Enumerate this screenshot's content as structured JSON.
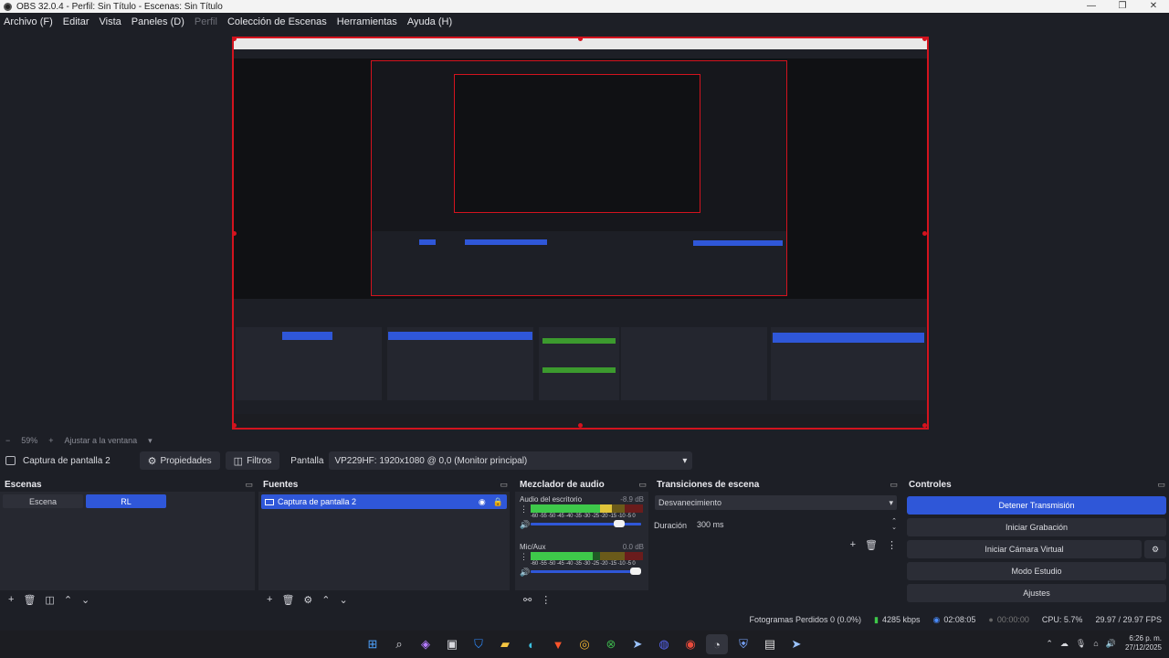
{
  "window": {
    "title": "OBS 32.0.4 - Perfil: Sin Título - Escenas: Sin Título"
  },
  "menu": [
    "Archivo (F)",
    "Editar",
    "Vista",
    "Paneles (D)",
    "Perfil",
    "Colección de Escenas",
    "Herramientas",
    "Ayuda (H)"
  ],
  "zoom": {
    "minus": "−",
    "value": "59%",
    "plus": "+",
    "fit_label": "Ajustar a la ventana"
  },
  "source_toolbar": {
    "source_name": "Captura de pantalla 2",
    "properties_label": "Propiedades",
    "filters_label": "Filtros",
    "screen_label": "Pantalla",
    "screen_value": "VP229HF: 1920x1080 @ 0,0 (Monitor principal)"
  },
  "scenes": {
    "title": "Escenas",
    "items": [
      "Escena",
      "RL"
    ],
    "active": "RL"
  },
  "sources": {
    "title": "Fuentes",
    "items": [
      "Captura de pantalla 2"
    ]
  },
  "mixer": {
    "title": "Mezclador de audio",
    "scale": "-60 -55 -50 -45 -40 -35 -30 -25 -20 -15 -10 -5 0",
    "channels": [
      {
        "name": "Audio del escritorio",
        "db": "-8.9 dB",
        "level": 0.72,
        "volume": 0.85
      },
      {
        "name": "Mic/Aux",
        "db": "0.0 dB",
        "level": 0.55,
        "volume": 1.0
      }
    ]
  },
  "transitions": {
    "title": "Transiciones de escena",
    "selected": "Desvanecimiento",
    "duration_label": "Duración",
    "duration_value": "300 ms"
  },
  "controls": {
    "title": "Controles",
    "buttons": [
      "Detener Transmisión",
      "Iniciar Grabación",
      "Iniciar Cámara Virtual",
      "Modo Estudio",
      "Ajustes"
    ]
  },
  "status": {
    "dropped": "Fotogramas Perdidos 0 (0.0%)",
    "bitrate": "4285 kbps",
    "stream_time": "02:08:05",
    "rec_time": "00:00:00",
    "cpu": "CPU: 5.7%",
    "fps": "29.97 / 29.97 FPS"
  },
  "taskbar": {
    "time": "6:26 p. m.",
    "date": "27/12/2025"
  },
  "colors": {
    "accent": "#2f57d8",
    "preview_border": "#d3131e",
    "background": "#1d1f26",
    "panel": "#262830"
  }
}
